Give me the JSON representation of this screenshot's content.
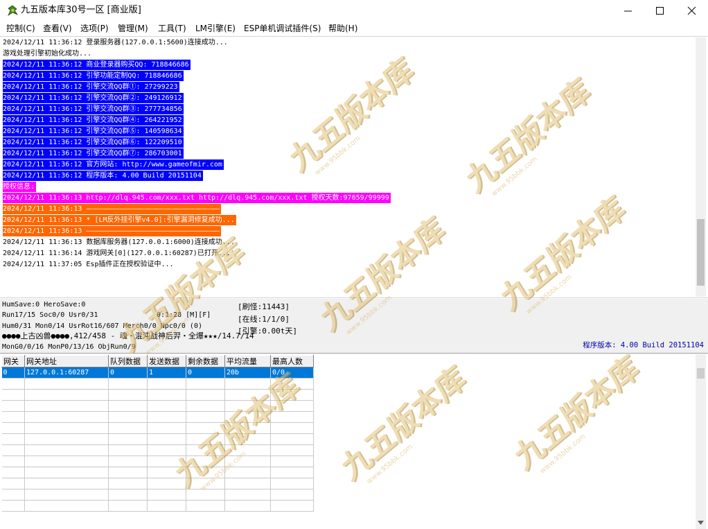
{
  "window": {
    "title": "九五版本库30号一区 [商业版]"
  },
  "menu": [
    {
      "label": "控制(C)"
    },
    {
      "label": "查看(V)"
    },
    {
      "label": "选项(P)"
    },
    {
      "label": "管理(M)"
    },
    {
      "label": "工具(T)"
    },
    {
      "label": "LM引擎(E)"
    },
    {
      "label": "ESP单机调试插件(S)"
    },
    {
      "label": "帮助(H)"
    }
  ],
  "log": [
    {
      "text": "2024/12/11 11:36:12 登录服务器(127.0.0.1:5600)连接成功...",
      "style": "normal"
    },
    {
      "text": "游戏处理引擎初始化成功...",
      "style": "normal"
    },
    {
      "text": "2024/12/11 11:36:12 商业登录器购买QQ: 718846686",
      "style": "blue"
    },
    {
      "text": "2024/12/11 11:36:12 引擎功能定制QQ: 718846686",
      "style": "blue"
    },
    {
      "text": "2024/12/11 11:36:12 引擎交流QQ群①: 27299223",
      "style": "blue"
    },
    {
      "text": "2024/12/11 11:36:12 引擎交流QQ群②: 249126912",
      "style": "blue"
    },
    {
      "text": "2024/12/11 11:36:12 引擎交流QQ群③: 277734856",
      "style": "blue"
    },
    {
      "text": "2024/12/11 11:36:12 引擎交流QQ群④: 264221952",
      "style": "blue"
    },
    {
      "text": "2024/12/11 11:36:12 引擎交流QQ群⑤: 140598634",
      "style": "blue"
    },
    {
      "text": "2024/12/11 11:36:12 引擎交流QQ群⑥: 122209510",
      "style": "blue"
    },
    {
      "text": "2024/12/11 11:36:12 引擎交流QQ群⑦: 286703001",
      "style": "blue"
    },
    {
      "text": "2024/12/11 11:36:12 官方网站: http://www.gameofmir.com",
      "style": "blue"
    },
    {
      "text": "2024/12/11 11:36:12 程序版本: 4.00 Build 20151104",
      "style": "blue"
    },
    {
      "text": "授权信息:",
      "style": "magenta"
    },
    {
      "text": "2024/12/11 11:36:13 http://dlq.945.com/xxx.txt http://dlq.945.com/xxx.txt 授权天数:97659/99999",
      "style": "magenta"
    },
    {
      "text": "2024/12/11 11:36:13 ————————————————————————————————",
      "style": "orange"
    },
    {
      "text": "2024/12/11 11:36:13 * [LM反外挂引擎v4.0]:引擎漏洞修复成功...",
      "style": "orange"
    },
    {
      "text": "2024/12/11 11:36:13 ————————————————————————————————",
      "style": "orange"
    },
    {
      "text": "2024/12/11 11:36:13 数据库服务器(127.0.0.1:6000)连接成功...",
      "style": "normal"
    },
    {
      "text": "2024/12/11 11:36:14 游戏网关[0](127.0.0.1:60287)已打开...",
      "style": "normal"
    },
    {
      "text": "2024/12/11 11:37:05 Esp插件正在授权验证中...",
      "style": "normal"
    }
  ],
  "colors": {
    "blue_bg": "#0000ff",
    "magenta_bg": "#ff00ff",
    "orange_bg": "#ff6600",
    "selection": "#0078d7"
  },
  "status": {
    "line1": "HumSave:0 HeroSave:0",
    "line2a": "Run17/15 Soc0/0 Usr0/31",
    "line2b": "0:1:28 [M][F]",
    "line3": "Hum0/31 Mon0/14 UsrRot16/607 Merch0/0 Npc0/0 (0)",
    "line4": "●●●●上古凶兽●●●●,412/458 - 魂・混沌战神后羿・全爆★★★/14.7/14",
    "line5": "MonG0/0/16 MonP0/13/16 ObjRun0/9",
    "refresh": "[刷怪:11443]",
    "online": "[在线:1/1/0]",
    "engine": "[引擎:0.00t天]",
    "program_version": "程序版本: 4.00 Build 20151104"
  },
  "grid": {
    "columns": [
      "网关",
      "网关地址",
      "队列数据",
      "发送数据",
      "剩余数据",
      "平均流量",
      "最高人数"
    ],
    "rows": [
      [
        "0",
        "127.0.0.1:60287",
        "0",
        "1",
        "0",
        "20b",
        "0/0"
      ]
    ],
    "empty_rows": 12
  },
  "watermark": {
    "text": "九五版本库",
    "sub": "www.95bbk.com"
  }
}
